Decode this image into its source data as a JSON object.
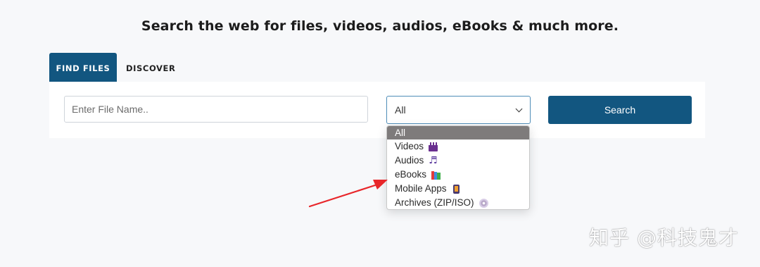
{
  "header": {
    "title": "Search the web for files, videos, audios, eBooks & much more."
  },
  "tabs": [
    {
      "label": "FIND FILES",
      "active": true
    },
    {
      "label": "DISCOVER",
      "active": false
    }
  ],
  "search": {
    "placeholder": "Enter File Name..",
    "value": "",
    "category_selected": "All",
    "button_label": "Search"
  },
  "dropdown": {
    "options": [
      {
        "label": "All",
        "icon": "",
        "selected": true
      },
      {
        "label": "Videos",
        "icon": "clapper-board-icon",
        "selected": false
      },
      {
        "label": "Audios",
        "icon": "music-notes-icon",
        "selected": false
      },
      {
        "label": "eBooks",
        "icon": "books-icon",
        "selected": false
      },
      {
        "label": "Mobile Apps",
        "icon": "mobile-phone-icon",
        "selected": false
      },
      {
        "label": "Archives (ZIP/ISO)",
        "icon": "disc-icon",
        "selected": false
      }
    ]
  },
  "watermark": {
    "text": "知乎 @科技鬼才"
  },
  "colors": {
    "primary": "#125680",
    "select_border": "#4f8db8",
    "selected_option_bg": "#7e7b7b",
    "annotation_arrow": "#e8262a",
    "page_bg": "#f7f8fa"
  }
}
